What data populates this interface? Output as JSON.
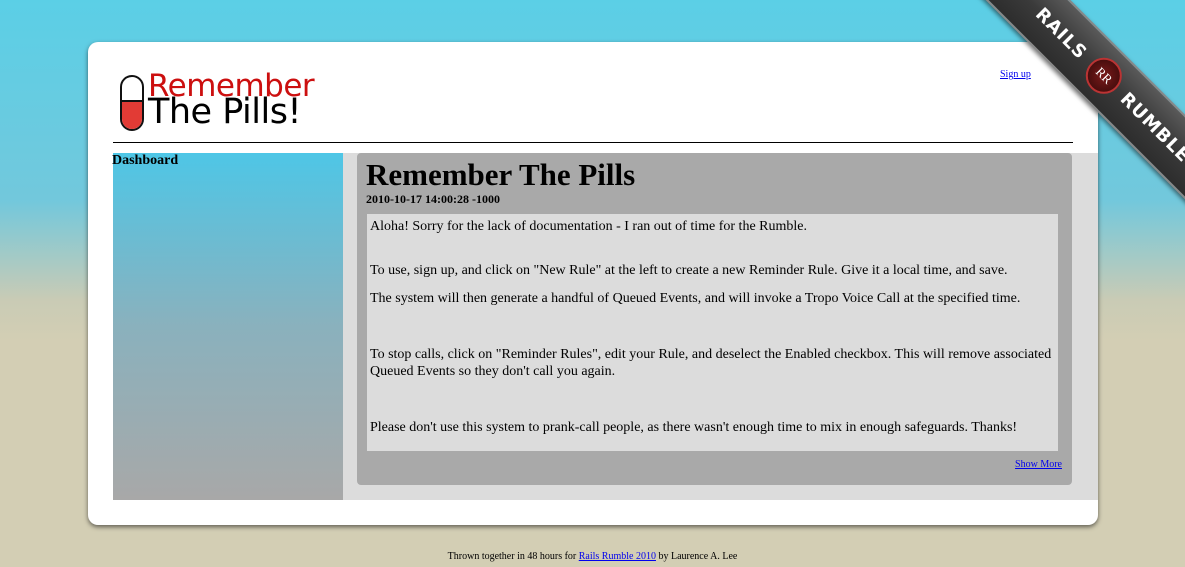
{
  "header": {
    "logo_line1": "Remember",
    "logo_line2": "The Pills!",
    "signup_label": "Sign up"
  },
  "sidebar": {
    "title": "Dashboard"
  },
  "post": {
    "title": "Remember The Pills",
    "date": "2010-10-17 14:00:28 -1000",
    "paragraphs": [
      "Aloha! Sorry for the lack of documentation - I ran out of time for the Rumble.",
      "To use, sign up, and click on \"New Rule\" at the left to create a new Reminder Rule. Give it a local time, and save.",
      "The system will then generate a handful of Queued Events, and will invoke a Tropo Voice Call at the specified time.",
      "To stop calls, click on \"Reminder Rules\", edit your Rule, and deselect the Enabled checkbox. This will remove associated Queued Events so they don't call you again.",
      "Please don't use this system to prank-call people, as there wasn't enough time to mix in enough safeguards. Thanks!"
    ],
    "show_more_label": "Show More"
  },
  "footer": {
    "prefix": "Thrown together in 48 hours for",
    "link_label": "Rails Rumble 2010",
    "suffix": "by Laurence A. Lee"
  },
  "ribbon": {
    "left_text": "RAILS",
    "badge_text": "RR",
    "right_text": "RUMBLE"
  },
  "colors": {
    "logo_red": "#cc0f0f",
    "link_blue": "#0000ee",
    "panel_gray": "#a9a9a9",
    "body_gray": "#dcdcdc"
  }
}
